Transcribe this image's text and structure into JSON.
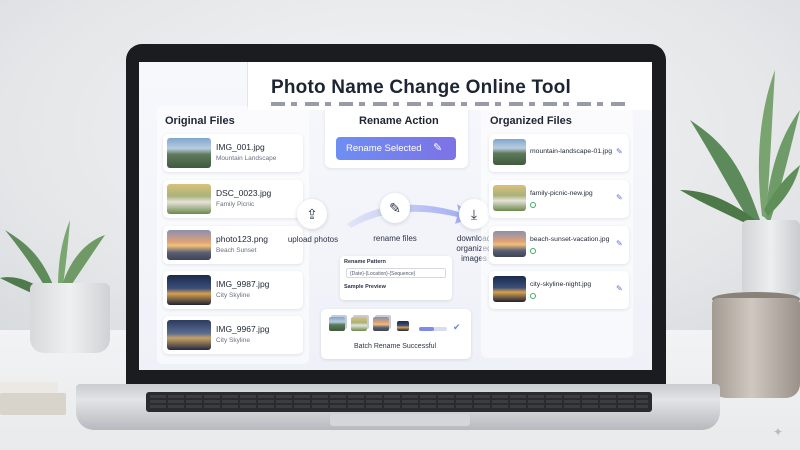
{
  "app": {
    "title": "Photo Name Change Online Tool"
  },
  "original_files": {
    "heading": "Original Files",
    "items": [
      {
        "name": "IMG_001.jpg",
        "desc": "Mountain Landscape",
        "thumb": "mountain-thumbnail"
      },
      {
        "name": "DSC_0023.jpg",
        "desc": "Family Picnic",
        "thumb": "picnic-thumbnail"
      },
      {
        "name": "photo123.png",
        "desc": "Beach Sunset",
        "thumb": "sunset-thumbnail"
      },
      {
        "name": "IMG_9987.jpg",
        "desc": "City Skyline",
        "thumb": "city-thumbnail"
      },
      {
        "name": "IMG_9967.jpg",
        "desc": "City Skyline",
        "thumb": "city-thumbnail"
      }
    ]
  },
  "rename_action": {
    "heading": "Rename Action",
    "button_label": "Rename Selected",
    "button_icon": "edit-icon"
  },
  "steps": [
    {
      "label": "upload photos",
      "icon": "upload-icon"
    },
    {
      "label": "rename files",
      "icon": "edit-icon"
    },
    {
      "label": "download organized images",
      "icon": "download-icon"
    }
  ],
  "pattern": {
    "label": "Rename Pattern",
    "value": "{Date}-{Location}-{Sequence}",
    "preview_label": "Sample Preview"
  },
  "batch": {
    "label": "Batch Rename Successful",
    "progress": 0.55,
    "status_icon": "check-circle-icon"
  },
  "organized_files": {
    "heading": "Organized Files",
    "items": [
      {
        "name": "mountain-landscape-01.jpg",
        "thumb": "mountain-thumbnail",
        "icon": "edit-icon"
      },
      {
        "name": "family-picnic-new.jpg",
        "thumb": "picnic-thumbnail",
        "icon": "edit-icon"
      },
      {
        "name": "beach-sunset-vacation.jpg",
        "thumb": "sunset-thumbnail",
        "icon": "edit-icon"
      },
      {
        "name": "city-skyline-night.jpg",
        "thumb": "city-thumbnail",
        "icon": "edit-icon"
      }
    ]
  },
  "colors": {
    "accent": "#7080ea",
    "check": "#34b35c",
    "text": "#1f2533"
  }
}
